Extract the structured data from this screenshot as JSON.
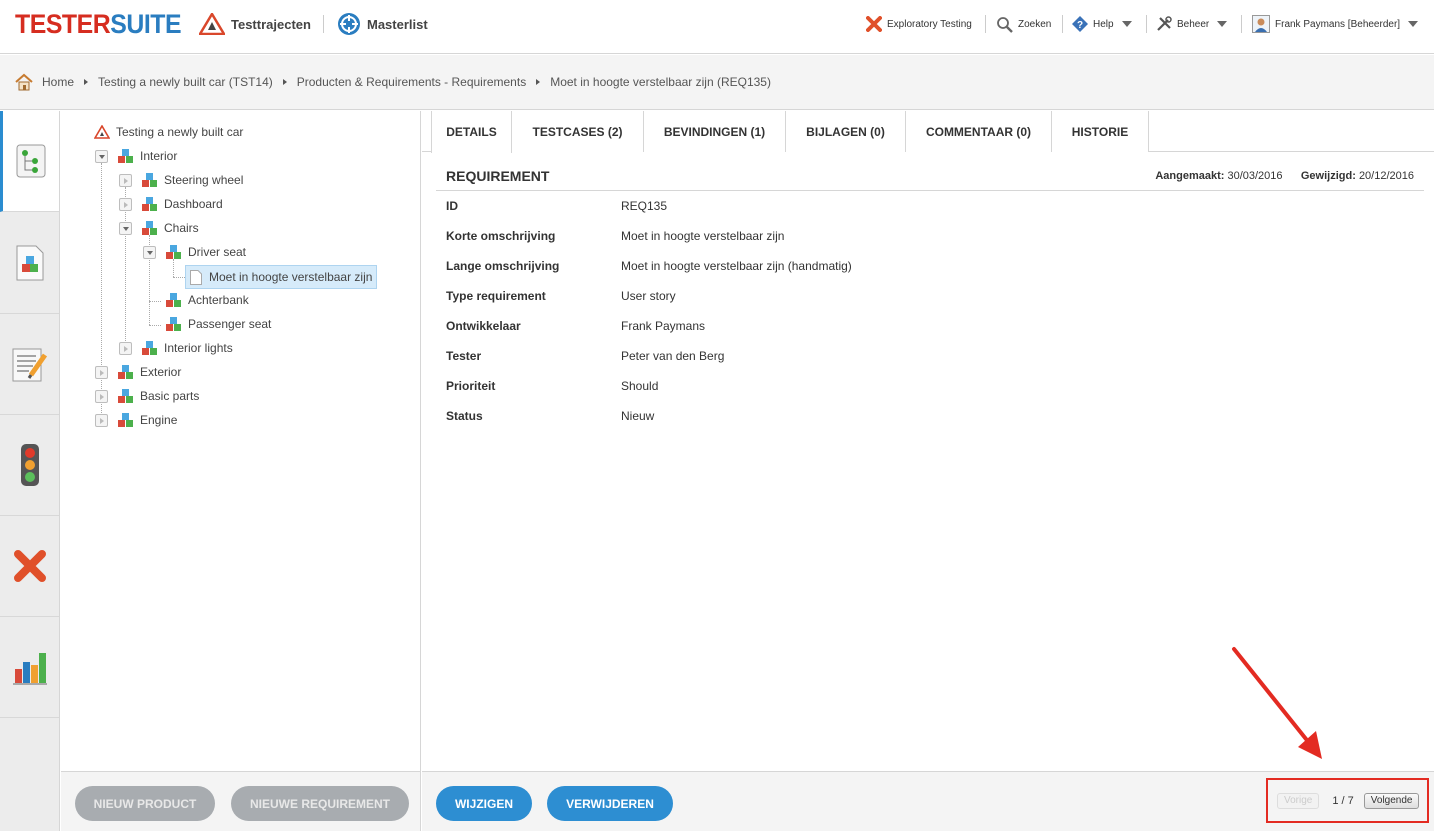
{
  "app": {
    "logo_part1": "TESTER",
    "logo_part2": "SUITE"
  },
  "topnav": {
    "testtrajecten": "Testtrajecten",
    "masterlist": "Masterlist"
  },
  "usernav": {
    "exploratory": "Exploratory Testing",
    "zoeken": "Zoeken",
    "help": "Help",
    "beheer": "Beheer",
    "user": "Frank Paymans [Beheerder]"
  },
  "breadcrumb": [
    "Home",
    "Testing a newly built car (TST14)",
    "Producten & Requirements - Requirements",
    "Moet in hoogte verstelbaar zijn (REQ135)"
  ],
  "toolbar_icons": [
    "mail-icon",
    "new-test-icon",
    "add-masterlist-icon",
    "link-masterlist-icon"
  ],
  "rail": [
    "tree-icon",
    "product-icon",
    "edit-notes-icon",
    "traffic-light-icon",
    "cancel-icon",
    "chart-icon"
  ],
  "tree": {
    "root": "Testing a newly built car",
    "interior": "Interior",
    "steering": "Steering wheel",
    "dashboard": "Dashboard",
    "chairs": "Chairs",
    "driver_seat": "Driver seat",
    "requirement": "Moet in hoogte verstelbaar zijn",
    "achterbank": "Achterbank",
    "passenger": "Passenger seat",
    "interior_lights": "Interior lights",
    "exterior": "Exterior",
    "basic_parts": "Basic parts",
    "engine": "Engine"
  },
  "tabs": [
    "DETAILS",
    "TESTCASES (2)",
    "BEVINDINGEN (1)",
    "BIJLAGEN (0)",
    "COMMENTAAR (0)",
    "HISTORIE"
  ],
  "active_tab": "DETAILS",
  "requirement": {
    "heading": "REQUIREMENT",
    "created_label": "Aangemaakt:",
    "created": "30/03/2016",
    "modified_label": "Gewijzigd:",
    "modified": "20/12/2016",
    "fields": [
      {
        "label": "ID",
        "value": "REQ135"
      },
      {
        "label": "Korte omschrijving",
        "value": "Moet in hoogte verstelbaar zijn"
      },
      {
        "label": "Lange omschrijving",
        "value": "Moet in hoogte verstelbaar zijn (handmatig)"
      },
      {
        "label": "Type requirement",
        "value": "User story"
      },
      {
        "label": "Ontwikkelaar",
        "value": "Frank Paymans"
      },
      {
        "label": "Tester",
        "value": "Peter van den Berg"
      },
      {
        "label": "Prioriteit",
        "value": "Should"
      },
      {
        "label": "Status",
        "value": "Nieuw"
      }
    ]
  },
  "actions": {
    "new_product": "NIEUW PRODUCT",
    "new_requirement": "NIEUWE REQUIREMENT",
    "edit": "WIJZIGEN",
    "delete": "VERWIJDEREN"
  },
  "pager": {
    "prev": "Vorige",
    "position": "1 / 7",
    "next": "Volgende"
  },
  "colors": {
    "accent_blue": "#2d8ed2",
    "logo_red": "#d62d20",
    "logo_blue": "#2a7dc0",
    "highlight_red": "#e32b22"
  }
}
